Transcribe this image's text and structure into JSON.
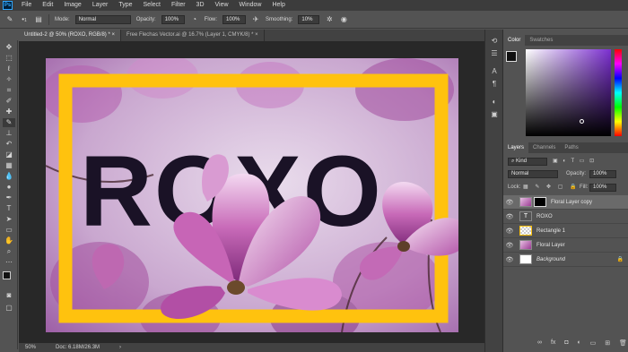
{
  "app": {
    "logo": "Ps"
  },
  "menu": [
    "File",
    "Edit",
    "Image",
    "Layer",
    "Type",
    "Select",
    "Filter",
    "3D",
    "View",
    "Window",
    "Help"
  ],
  "options": {
    "mode_label": "Mode:",
    "mode_value": "Normal",
    "opacity_label": "Opacity:",
    "opacity_value": "100%",
    "flow_label": "Flow:",
    "flow_value": "100%",
    "smoothing_label": "Smoothing:",
    "smoothing_value": "10%",
    "brush_size": "1"
  },
  "tabs": [
    {
      "label": "Untitled-2 @ 50% (ROXO, RGB/8) * ×",
      "active": true
    },
    {
      "label": "Free Flechas Vector.ai @ 16.7% (Layer 1, CMYK/8) * ×",
      "active": false
    }
  ],
  "artwork": {
    "text": "ROXO",
    "frame_color": "#ffc20e",
    "text_color": "#1a1226"
  },
  "status": {
    "zoom": "50%",
    "doc": "Doc: 6.18M/26.3M"
  },
  "color_panel": {
    "tabs": [
      "Color",
      "Swatches"
    ],
    "accent_hue": "#7b2fd0"
  },
  "layers_panel": {
    "tabs": [
      "Layers",
      "Channels",
      "Paths"
    ],
    "kind": "Kind",
    "blend": "Normal",
    "opacity_label": "Opacity:",
    "opacity_value": "100%",
    "lock_label": "Lock:",
    "fill_label": "Fill:",
    "fill_value": "100%",
    "layers": [
      {
        "name": "Floral Layer copy",
        "thumb": "floral",
        "selected": true
      },
      {
        "name": "ROXO",
        "thumb": "text",
        "selected": false
      },
      {
        "name": "Rectangle 1",
        "thumb": "rect",
        "selected": false
      },
      {
        "name": "Floral Layer",
        "thumb": "floral",
        "selected": false
      },
      {
        "name": "Background",
        "thumb": "white",
        "selected": false
      }
    ],
    "footer_icons": [
      "link-icon",
      "fx-icon",
      "mask-icon",
      "adjustment-icon",
      "group-icon",
      "new-layer-icon",
      "trash-icon"
    ]
  }
}
